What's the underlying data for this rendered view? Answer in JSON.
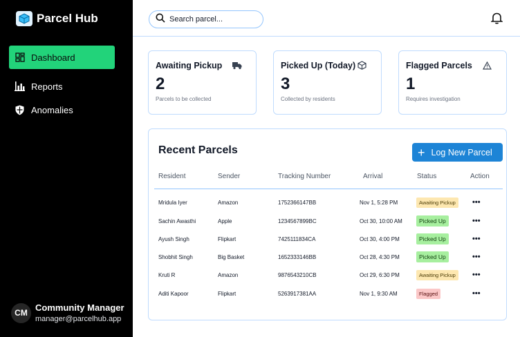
{
  "app": {
    "name": "Parcel Hub"
  },
  "sidebar": {
    "items": [
      {
        "label": "Dashboard",
        "icon": "grid-icon",
        "active": true
      },
      {
        "label": "Reports",
        "icon": "bar-chart-icon"
      },
      {
        "label": "Anomalies",
        "icon": "shield-icon"
      }
    ]
  },
  "user": {
    "initials": "CM",
    "name": "Community Manager",
    "email": "manager@parcelhub.app"
  },
  "search": {
    "placeholder": "Search parcel..."
  },
  "stats": [
    {
      "title": "Awaiting Pickup",
      "value": "2",
      "sub": "Parcels to be collected",
      "icon": "truck-icon"
    },
    {
      "title": "Picked Up (Today)",
      "value": "3",
      "sub": "Collected by residents",
      "icon": "box-icon"
    },
    {
      "title": "Flagged Parcels",
      "value": "1",
      "sub": "Requires investigation",
      "icon": "warning-icon"
    }
  ],
  "recent": {
    "title": "Recent Parcels",
    "button": "Log New Parcel",
    "columns": [
      "Resident",
      "Sender",
      "Tracking Number",
      "Arrival",
      "Status",
      "Action"
    ],
    "rows": [
      {
        "resident": "Mridula Iyer",
        "sender": "Amazon",
        "tracking": "1752366147BB",
        "arrival": "Nov 1, 5:28 PM",
        "status": "Awaiting Pickup",
        "kind": "awaiting"
      },
      {
        "resident": "Sachin Awasthi",
        "sender": "Apple",
        "tracking": "1234567899BC",
        "arrival": "Oct 30, 10:00 AM",
        "status": "Picked Up",
        "kind": "picked"
      },
      {
        "resident": "Ayush Singh",
        "sender": "Flipkart",
        "tracking": "7425111834CA",
        "arrival": "Oct 30, 4:00 PM",
        "status": "Picked Up",
        "kind": "picked"
      },
      {
        "resident": "Shobhit Singh",
        "sender": "Big Basket",
        "tracking": "1652333146BB",
        "arrival": "Oct 28, 4:30 PM",
        "status": "Picked Up",
        "kind": "picked"
      },
      {
        "resident": "Kruti R",
        "sender": "Amazon",
        "tracking": "9876543210CB",
        "arrival": "Oct 29, 6:30 PM",
        "status": "Awaiting Pickup",
        "kind": "awaiting"
      },
      {
        "resident": "Aditi Kapoor",
        "sender": "Flipkart",
        "tracking": "5263917381AA",
        "arrival": "Nov 1, 9:30 AM",
        "status": "Flagged",
        "kind": "flagged"
      }
    ],
    "action_label": "•••"
  },
  "colors": {
    "accent": "#22d37a",
    "primary": "#1d84d6",
    "border": "#bfdbfe"
  }
}
